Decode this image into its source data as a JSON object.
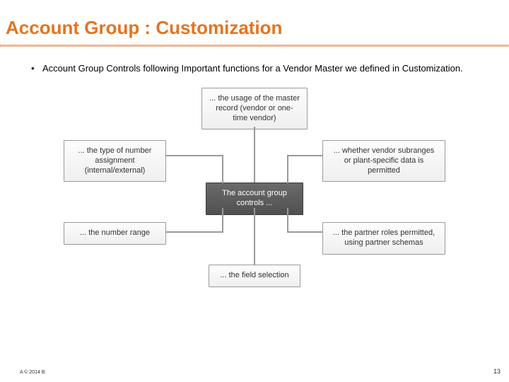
{
  "title": "Account Group : Customization",
  "bullet": "Account Group Controls following Important functions for a Vendor Master we defined in Customization.",
  "diagram": {
    "center": "The account group controls ...",
    "top": "... the usage of the master record (vendor or one-time vendor)",
    "left1": "... the type of number assignment (internal/external)",
    "left2": "... the number range",
    "right1": "... whether vendor subranges or plant-specific data is permitted",
    "right2": "... the partner roles permitted, using partner schemas",
    "bottom": "... the field selection"
  },
  "footer": {
    "left": "A © 2014 B.",
    "right": "13"
  }
}
